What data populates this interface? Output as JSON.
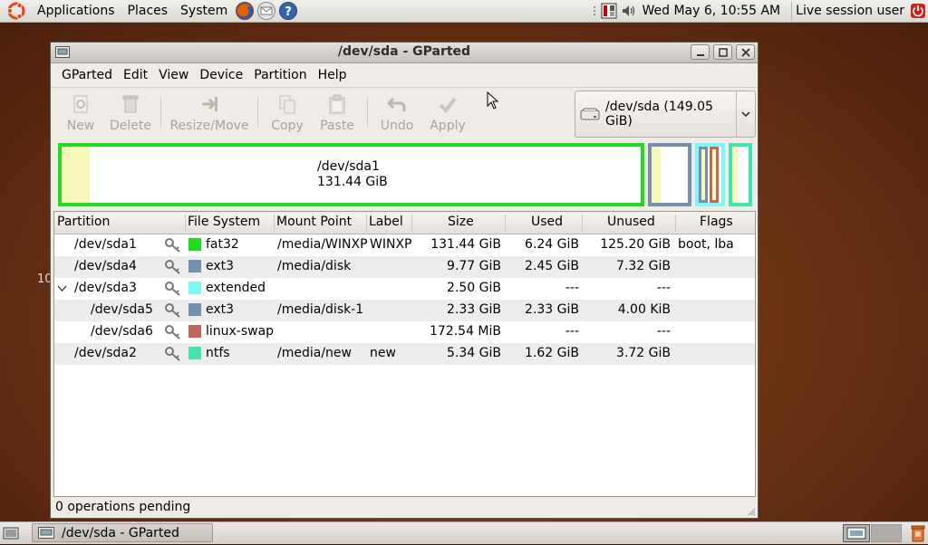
{
  "top_panel": {
    "menus": [
      "Applications",
      "Places",
      "System"
    ],
    "clock": "Wed May  6, 10:55 AM",
    "session": "Live session user"
  },
  "desktop_fragment": "10",
  "window": {
    "title": "/dev/sda - GParted",
    "menubar": [
      "GParted",
      "Edit",
      "View",
      "Device",
      "Partition",
      "Help"
    ],
    "toolbar": {
      "new": "New",
      "delete": "Delete",
      "resize": "Resize/Move",
      "copy": "Copy",
      "paste": "Paste",
      "undo": "Undo",
      "apply": "Apply"
    },
    "device": "/dev/sda   (149.05 GiB)",
    "diskmap": {
      "selected_name": "/dev/sda1",
      "selected_size": "131.44 GiB"
    },
    "columns": {
      "partition": "Partition",
      "filesystem": "File System",
      "mountpoint": "Mount Point",
      "label": "Label",
      "size": "Size",
      "used": "Used",
      "unused": "Unused",
      "flags": "Flags"
    },
    "rows": [
      {
        "partition": "/dev/sda1",
        "filesystem": "fat32",
        "color": "#1edc1e",
        "mountpoint": "/media/WINXP",
        "label": "WINXP",
        "size": "131.44 GiB",
        "used": "6.24 GiB",
        "unused": "125.20 GiB",
        "flags": "boot, lba"
      },
      {
        "partition": "/dev/sda4",
        "filesystem": "ext3",
        "color": "#7590ae",
        "mountpoint": "/media/disk",
        "label": "",
        "size": "9.77 GiB",
        "used": "2.45 GiB",
        "unused": "7.32 GiB",
        "flags": ""
      },
      {
        "partition": "/dev/sda3",
        "filesystem": "extended",
        "color": "#7ef7f7",
        "mountpoint": "",
        "label": "",
        "size": "2.50 GiB",
        "used": "---",
        "unused": "---",
        "flags": ""
      },
      {
        "partition": "/dev/sda5",
        "filesystem": "ext3",
        "color": "#7590ae",
        "mountpoint": "/media/disk-1",
        "label": "",
        "size": "2.33 GiB",
        "used": "2.33 GiB",
        "unused": "4.00 KiB",
        "flags": ""
      },
      {
        "partition": "/dev/sda6",
        "filesystem": "linux-swap",
        "color": "#c1665a",
        "mountpoint": "",
        "label": "",
        "size": "172.54 MiB",
        "used": "---",
        "unused": "---",
        "flags": ""
      },
      {
        "partition": "/dev/sda2",
        "filesystem": "ntfs",
        "color": "#42e5ac",
        "mountpoint": "/media/new",
        "label": "new",
        "size": "5.34 GiB",
        "used": "1.62 GiB",
        "unused": "3.72 GiB",
        "flags": ""
      }
    ],
    "status": "0 operations pending"
  },
  "bottom_panel": {
    "task": "/dev/sda - GParted"
  },
  "colors": {
    "fat32": "#1edc1e",
    "ext3": "#7590ae",
    "extended": "#7ef7f7",
    "swap": "#c1665a",
    "ntfs": "#42e5ac",
    "used_fill": "#f8f8b8"
  }
}
